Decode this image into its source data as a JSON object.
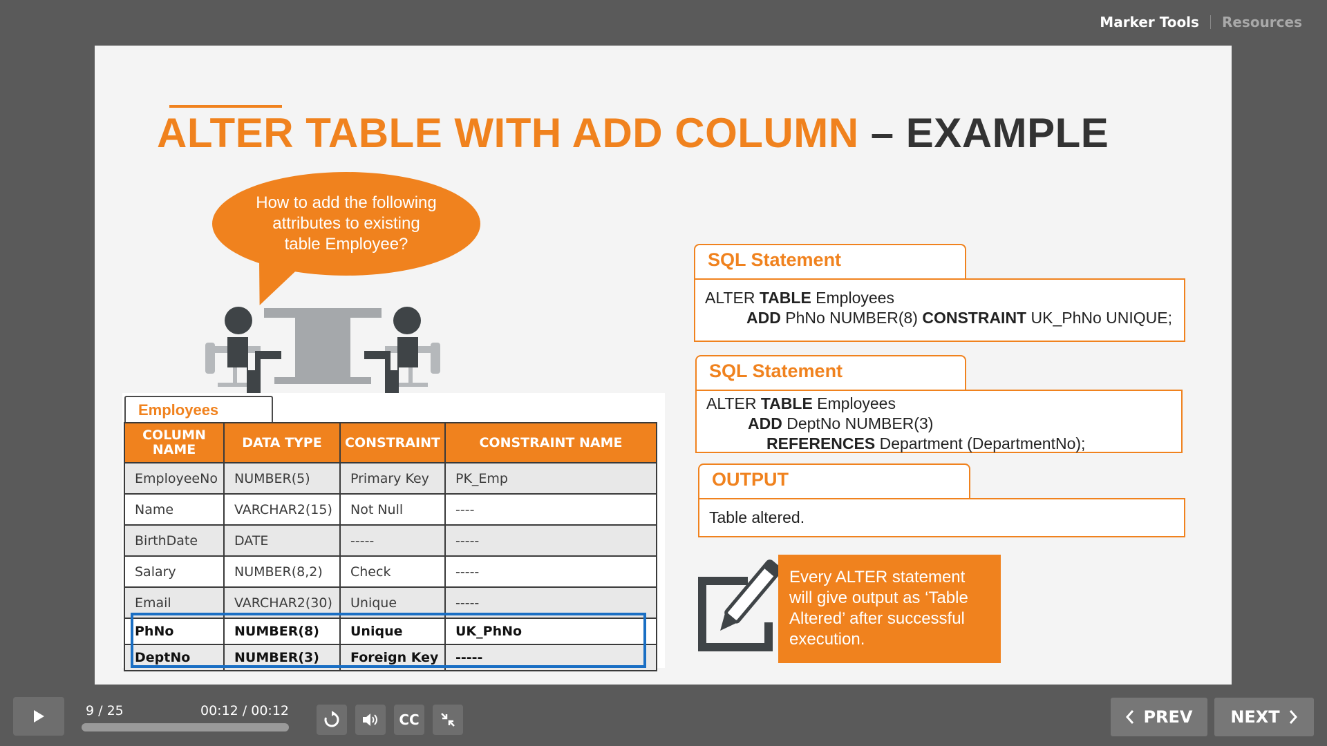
{
  "topnav": {
    "marker_tools": "Marker Tools",
    "resources": "Resources"
  },
  "slide": {
    "title_orange": "ALTER TABLE WITH ADD COLUMN",
    "title_dark": " – EXAMPLE",
    "bubble_text": "How to add the following attributes to existing table Employee?",
    "employees_tab": "Employees",
    "table": {
      "headers": [
        "COLUMN NAME",
        "DATA TYPE",
        "CONSTRAINT",
        "CONSTRAINT NAME"
      ],
      "rows": [
        [
          "EmployeeNo",
          "NUMBER(5)",
          "Primary Key",
          "PK_Emp"
        ],
        [
          "Name",
          "VARCHAR2(15)",
          "Not Null",
          "----"
        ],
        [
          "BirthDate",
          "DATE",
          "-----",
          "-----"
        ],
        [
          "Salary",
          "NUMBER(8,2)",
          "Check",
          "-----"
        ],
        [
          "Email",
          "VARCHAR2(30)",
          "Unique",
          "-----"
        ],
        [
          "PhNo",
          "NUMBER(8)",
          "Unique",
          "UK_PhNo"
        ],
        [
          "DeptNo",
          "NUMBER(3)",
          "Foreign Key",
          "-----"
        ]
      ]
    },
    "sql1": {
      "label": "SQL Statement",
      "l1_a": "ALTER ",
      "l1_kw": "TABLE",
      "l1_b": " Employees",
      "l2_kw1": "ADD",
      "l2_a": " PhNo NUMBER(8) ",
      "l2_kw2": "CONSTRAINT",
      "l2_b": " UK_PhNo UNIQUE;"
    },
    "sql2": {
      "label": "SQL Statement",
      "l1_a": "ALTER ",
      "l1_kw": "TABLE",
      "l1_b": " Employees",
      "l2_kw": "ADD",
      "l2_b": " DeptNo  NUMBER(3)",
      "l3_kw": "REFERENCES",
      "l3_b": "  Department (DepartmentNo);"
    },
    "output": {
      "label": "OUTPUT",
      "text": "Table altered."
    },
    "note": "Every ALTER statement will give output as ‘Table Altered’ after successful execution."
  },
  "player": {
    "slide_count": "9 / 25",
    "time": "00:12 / 00:12",
    "progress": 1.0,
    "cc_label": "CC",
    "prev_label": "PREV",
    "next_label": "NEXT"
  },
  "colors": {
    "accent": "#f0821e",
    "highlight_border": "#1a6fc4",
    "chrome": "#5a5a5a"
  }
}
